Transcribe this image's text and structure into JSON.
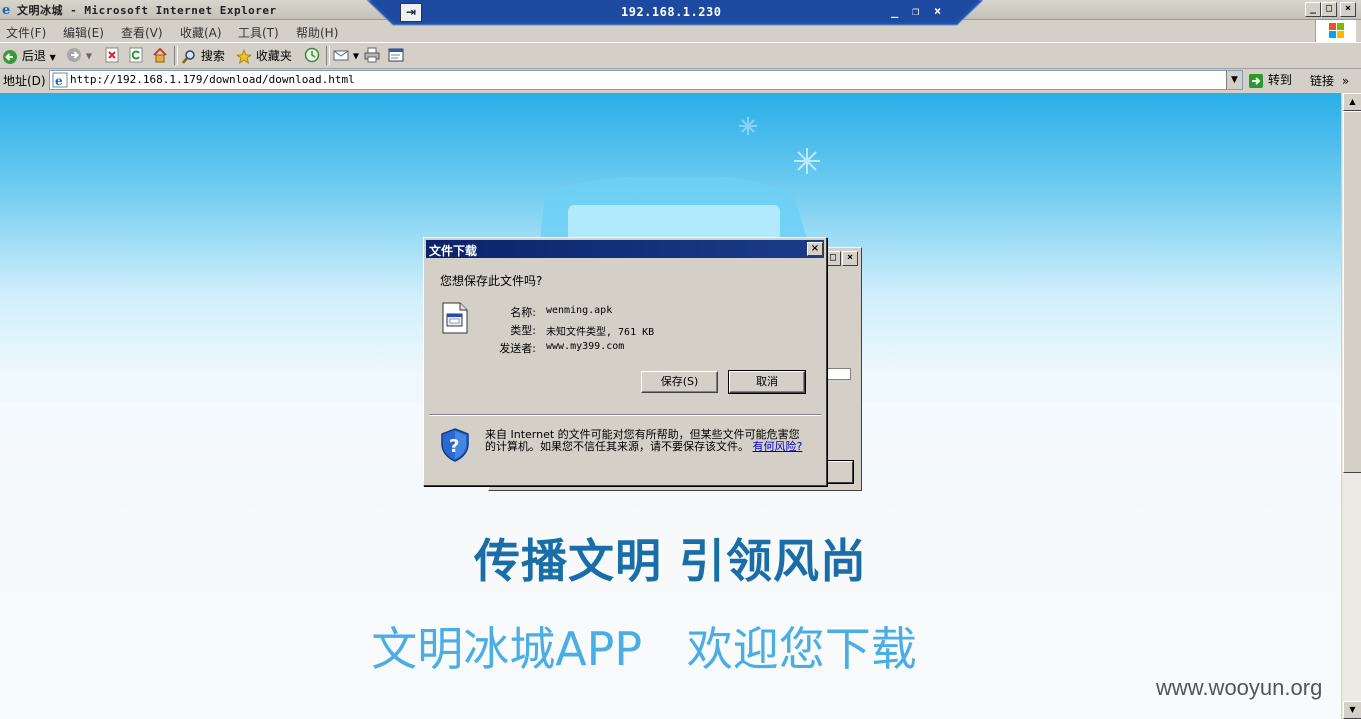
{
  "window": {
    "title": "文明冰城 - Microsoft Internet Explorer",
    "caption_buttons": [
      "_",
      "□",
      "×"
    ]
  },
  "rdp": {
    "host": "192.168.1.230",
    "pin_glyph": "⇥",
    "min_glyph": "_",
    "restore_glyph": "❐",
    "close_glyph": "×"
  },
  "menu": {
    "items": [
      "文件(F)",
      "编辑(E)",
      "查看(V)",
      "收藏(A)",
      "工具(T)",
      "帮助(H)"
    ]
  },
  "toolbar": {
    "back": "后退",
    "search": "搜索",
    "favorites": "收藏夹"
  },
  "address": {
    "label": "地址(D)",
    "url": "http://192.168.1.179/download/download.html",
    "go": "转到",
    "links": "链接",
    "more": "»"
  },
  "page": {
    "slogan": "传播文明 引领风尚",
    "welcome": "文明冰城APP 欢迎您下载",
    "watermark": "www.wooyun.org"
  },
  "dialog": {
    "title": "文件下载",
    "close": "×",
    "question": "您想保存此文件吗?",
    "name_label": "名称:",
    "name_value": "wenming.apk",
    "type_label": "类型:",
    "type_value": "未知文件类型, 761 KB",
    "from_label": "发送者:",
    "from_value": "www.my399.com",
    "save": "保存(S)",
    "cancel": "取消",
    "warning": "来自 Internet 的文件可能对您有所帮助，但某些文件可能危害您的计算机。如果您不信任其来源，请不要保存该文件。",
    "risk_link": "有何风险?"
  },
  "colors": {
    "dialog_title": "#0a246a",
    "slogan": "#1a6ea8",
    "welcome": "#4aaee4"
  }
}
